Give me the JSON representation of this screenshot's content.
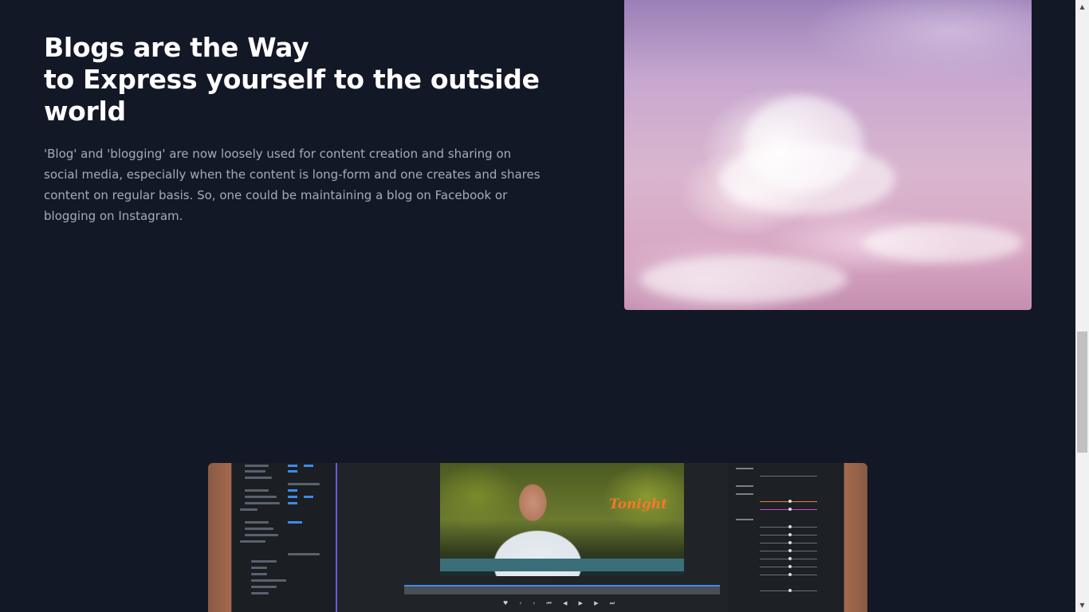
{
  "hero": {
    "title_line1": "Blogs are the Way",
    "title_line2": "to Express yourself to the outside",
    "title_line3": "world",
    "body": "'Blog' and 'blogging' are now loosely used for content creation and sharing on social media, especially when the content is long-form and one creates and shares content on regular basis. So, one could be maintaining a blog on Facebook or blogging on Instagram."
  },
  "images": {
    "sky": "pink-purple cloudy sky photo",
    "editor": "video editing software on laptop screen"
  },
  "editor_caption": "Tonight",
  "scrollbar": {
    "up_icon": "arrow-up-icon",
    "down_icon": "arrow-down-icon"
  },
  "colors": {
    "background": "#131827",
    "title": "#ffffff",
    "body": "#a3abbb"
  }
}
